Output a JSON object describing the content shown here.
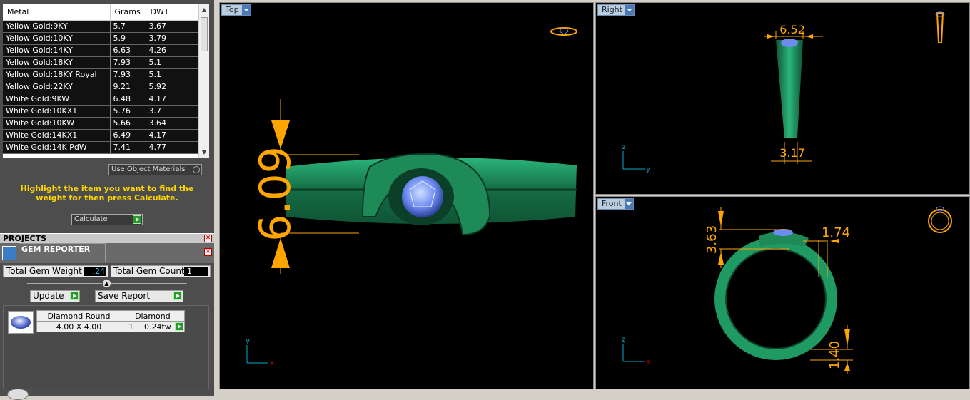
{
  "metal_table": {
    "headers": [
      "Metal",
      "Grams",
      "DWT"
    ],
    "rows": [
      [
        "Yellow Gold:9KY",
        "5.7",
        "3.67"
      ],
      [
        "Yellow Gold:10KY",
        "5.9",
        "3.79"
      ],
      [
        "Yellow Gold:14KY",
        "6.63",
        "4.26"
      ],
      [
        "Yellow Gold:18KY",
        "7.93",
        "5.1"
      ],
      [
        "Yellow Gold:18KY Royal",
        "7.93",
        "5.1"
      ],
      [
        "Yellow Gold:22KY",
        "9.21",
        "5.92"
      ],
      [
        "White Gold:9KW",
        "6.48",
        "4.17"
      ],
      [
        "White Gold:10KX1",
        "5.76",
        "3.7"
      ],
      [
        "White Gold:10KW",
        "5.66",
        "3.64"
      ],
      [
        "White Gold:14KX1",
        "6.49",
        "4.17"
      ],
      [
        "White Gold:14K PdW",
        "7.41",
        "4.77"
      ]
    ]
  },
  "use_object_materials": "Use Object Materials",
  "hint": "Highlight the item you want to find the weight for then press Calculate.",
  "calculate_label": "Calculate",
  "projects_label": "PROJECTS",
  "gem_reporter": {
    "title": "GEM REPORTER",
    "total_weight_label": "Total Gem Weight",
    "total_weight_value": ".24",
    "total_count_label": "Total Gem Count",
    "total_count_value": "1",
    "update_label": "Update",
    "save_report_label": "Save Report",
    "gem": {
      "name": "Diamond Round",
      "type": "Diamond",
      "size": "4.00 X 4.00",
      "qty": "1",
      "weight": "0.24tw"
    }
  },
  "viewports": {
    "top": {
      "label": "Top",
      "dim": "6.09"
    },
    "right": {
      "label": "Right",
      "dim_top": "6.52",
      "dim_bottom": "3.17"
    },
    "front": {
      "label": "Front",
      "dim_a": "3.63",
      "dim_b": "1.74",
      "dim_c": "1.40"
    }
  },
  "colors": {
    "ring": "#1f9a62",
    "dimension": "#ffa500",
    "gem": "#6d8cf0"
  }
}
